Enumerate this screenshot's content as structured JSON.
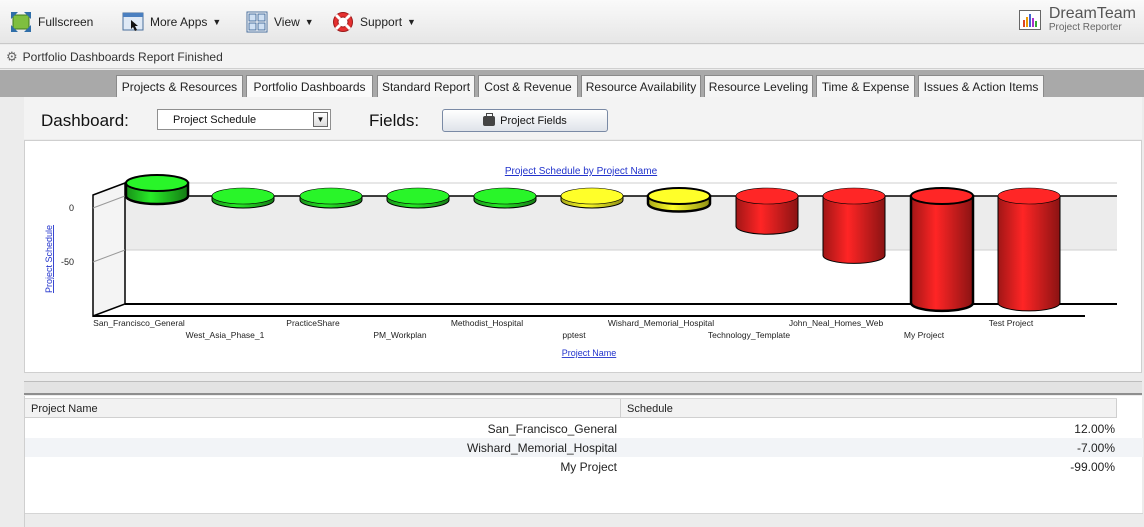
{
  "toolbar": {
    "fullscreen_label": "Fullscreen",
    "more_apps_label": "More Apps",
    "view_label": "View",
    "support_label": "Support"
  },
  "brand": {
    "title": "DreamTeam",
    "subtitle": "Project Reporter"
  },
  "status": {
    "text": "Portfolio Dashboards Report Finished"
  },
  "tabs": [
    {
      "label": "Projects & Resources"
    },
    {
      "label": "Portfolio Dashboards"
    },
    {
      "label": "Standard Report"
    },
    {
      "label": "Cost & Revenue"
    },
    {
      "label": "Resource Availability"
    },
    {
      "label": "Resource Leveling"
    },
    {
      "label": "Time & Expense"
    },
    {
      "label": "Issues & Action Items"
    }
  ],
  "active_tab": "Portfolio Dashboards",
  "dashboard": {
    "label": "Dashboard:",
    "selected": "Project Schedule",
    "fields_label": "Fields:",
    "fields_button": "Project Fields"
  },
  "chart_data": {
    "type": "bar",
    "title": "Project Schedule by Project Name",
    "xlabel": "Project Name",
    "ylabel": "Project Schedule",
    "yticks": [
      "0",
      "-50"
    ],
    "ylim": [
      -100,
      10
    ],
    "categories": [
      "San_Francisco_General",
      "West_Asia_Phase_1",
      "PracticeShare",
      "PM_Workplan",
      "Methodist_Hospital",
      "pptest",
      "Wishard_Memorial_Hospital",
      "Technology_Template",
      "John_Neal_Homes_Web",
      "My Project",
      "Test Project"
    ],
    "values": [
      12,
      0,
      0,
      0,
      0,
      0,
      -7,
      -28,
      -55,
      -99,
      -99
    ],
    "colors": [
      "#22cc22",
      "#22cc22",
      "#22cc22",
      "#22cc22",
      "#22cc22",
      "#eeee22",
      "#eeee22",
      "#e62020",
      "#e62020",
      "#e62020",
      "#e62020"
    ],
    "outlined": [
      true,
      false,
      false,
      false,
      false,
      false,
      true,
      false,
      false,
      true,
      false
    ]
  },
  "table": {
    "columns": [
      "Project Name",
      "Schedule"
    ],
    "rows": [
      {
        "name": "San_Francisco_General",
        "schedule": "12.00%"
      },
      {
        "name": "Wishard_Memorial_Hospital",
        "schedule": "-7.00%"
      },
      {
        "name": "My Project",
        "schedule": "-99.00%"
      }
    ]
  }
}
